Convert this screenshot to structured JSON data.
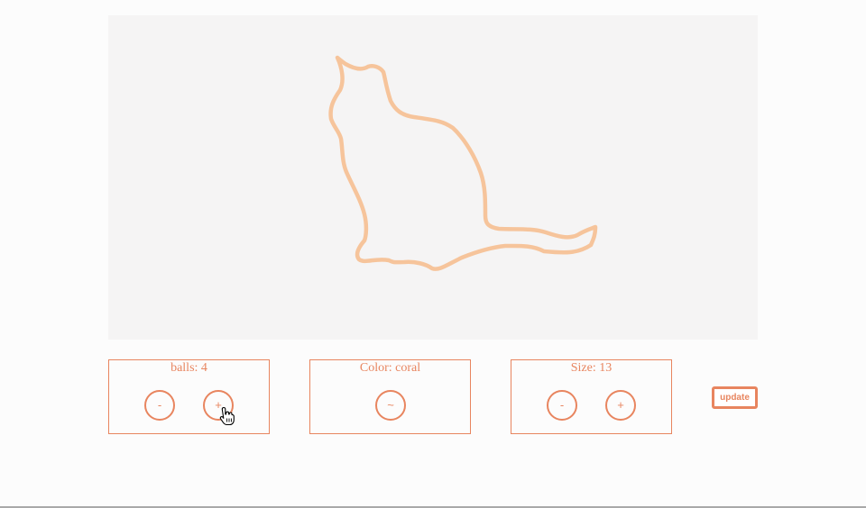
{
  "controls": {
    "balls": {
      "title": "balls: 4",
      "minus_label": "-",
      "plus_label": "+"
    },
    "color": {
      "title": "Color: coral",
      "cycle_label": "~"
    },
    "size": {
      "title": "Size: 13",
      "minus_label": "-",
      "plus_label": "+"
    }
  },
  "update_label": "update",
  "colors": {
    "accent": "#e8855f",
    "cat_stroke": "#f6c49b",
    "canvas_bg": "#f5f4f4"
  }
}
